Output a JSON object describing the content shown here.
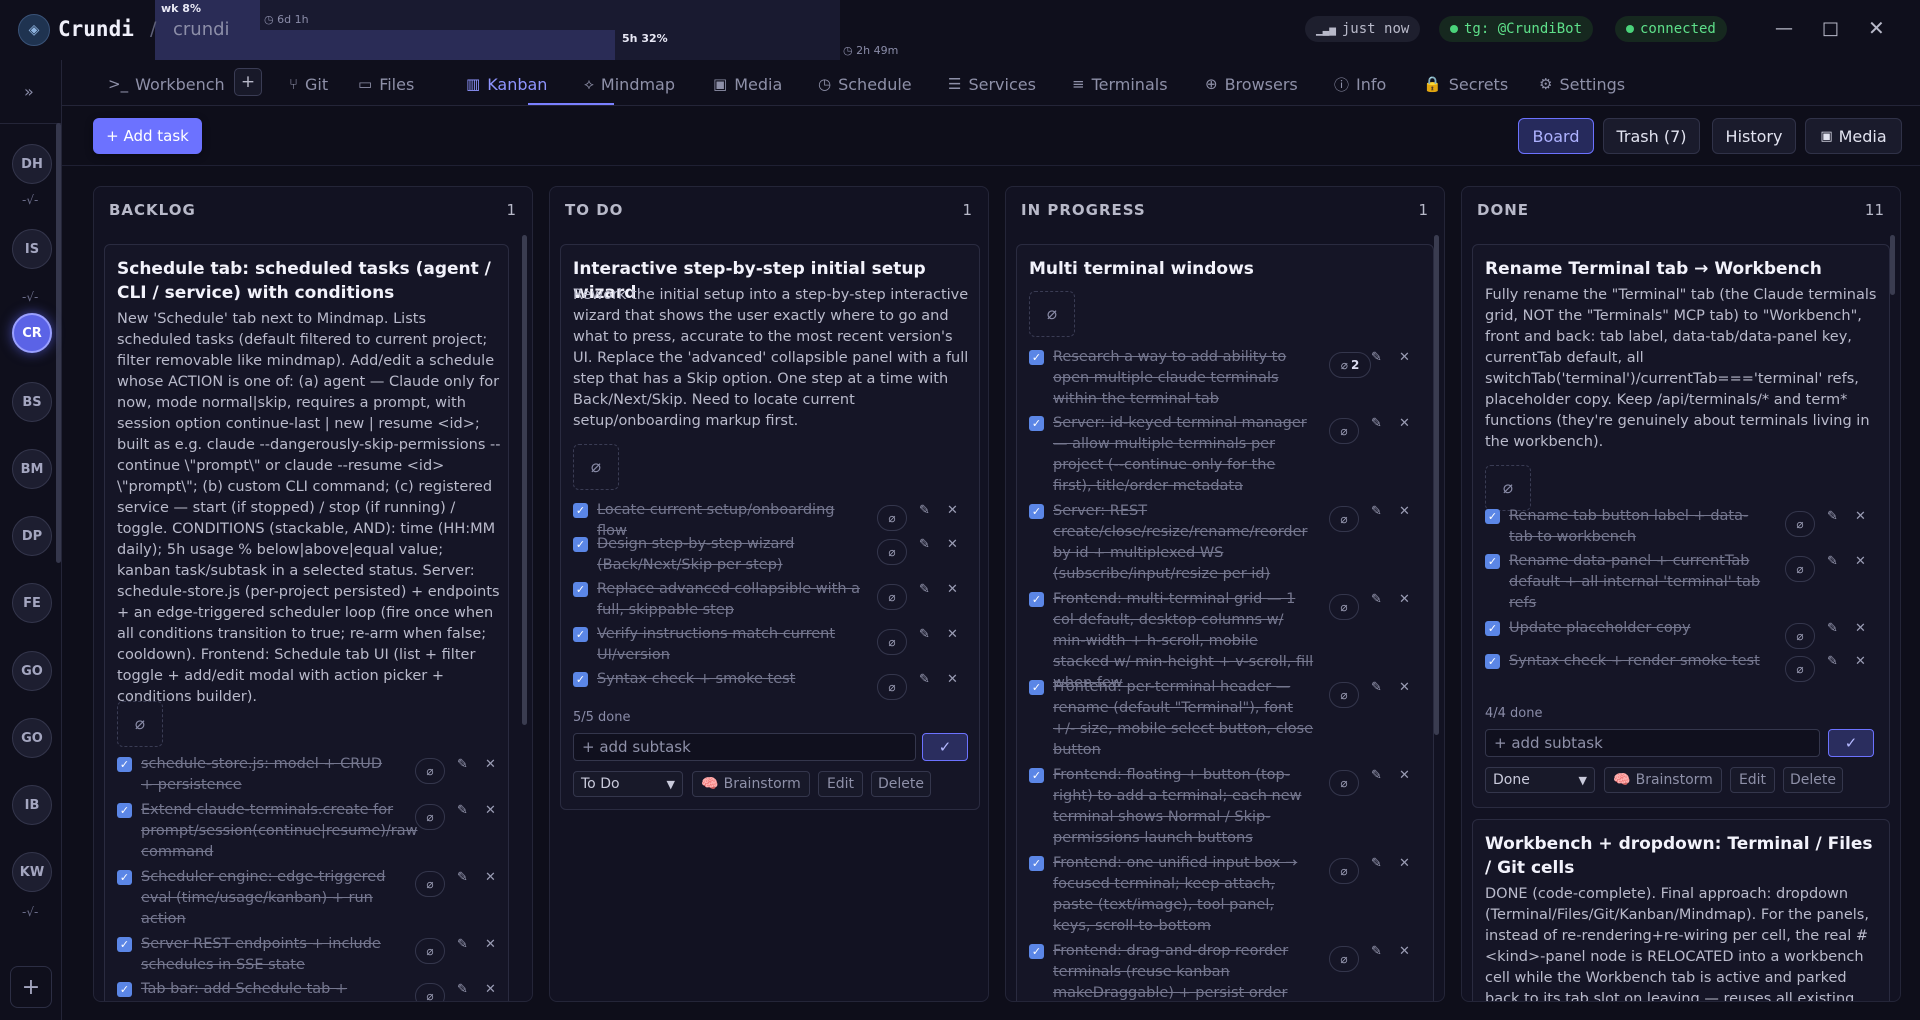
{
  "app": {
    "title": "Crundi",
    "project": "crundi"
  },
  "usage": {
    "week": {
      "label": "wk 8%",
      "reset": "6d 1h",
      "fraction": 0.08
    },
    "session": {
      "label": "5h 32%",
      "reset": "2h 49m",
      "fraction": 0.32
    }
  },
  "status": {
    "updated": "just now",
    "telegram": "tg: @CrundiBot",
    "connection": "connected"
  },
  "window_controls": {
    "minimize": "—",
    "maximize": "□",
    "close": "✕"
  },
  "rail": {
    "expand": "»",
    "projects": [
      "DH",
      "IS",
      "CR",
      "BS",
      "BM",
      "DP",
      "FE",
      "GO",
      "GO",
      "IB",
      "KW"
    ],
    "active_index": 2,
    "add": "+"
  },
  "tabs": [
    {
      "label": "Workbench",
      "icon": "terminal-icon",
      "glyph": ">_"
    },
    {
      "label": "Git",
      "icon": "git-branch-icon",
      "glyph": "⑂"
    },
    {
      "label": "Files",
      "icon": "folder-icon",
      "glyph": "▭"
    },
    {
      "label": "Kanban",
      "icon": "kanban-icon",
      "glyph": "▥"
    },
    {
      "label": "Mindmap",
      "icon": "mindmap-icon",
      "glyph": "⟡"
    },
    {
      "label": "Media",
      "icon": "image-icon",
      "glyph": "▣"
    },
    {
      "label": "Schedule",
      "icon": "clock-icon",
      "glyph": "◷"
    },
    {
      "label": "Services",
      "icon": "server-icon",
      "glyph": "☰"
    },
    {
      "label": "Terminals",
      "icon": "list-icon",
      "glyph": "≡"
    },
    {
      "label": "Browsers",
      "icon": "globe-icon",
      "glyph": "⊕"
    },
    {
      "label": "Info",
      "icon": "info-icon",
      "glyph": "ⓘ"
    },
    {
      "label": "Secrets",
      "icon": "lock-icon",
      "glyph": "🔒"
    },
    {
      "label": "Settings",
      "icon": "gear-icon",
      "glyph": "⚙"
    }
  ],
  "active_tab": "Kanban",
  "tab_add": "+",
  "toolbar": {
    "add_task": "+ Add task",
    "board": "Board",
    "trash": "Trash (7)",
    "history": "History",
    "media": "Media"
  },
  "columns": {
    "backlog": {
      "title": "BACKLOG",
      "count": "1",
      "card": {
        "title": "Schedule tab: scheduled tasks (agent / CLI / service) with conditions",
        "description": "New 'Schedule' tab next to Mindmap. Lists scheduled tasks (default filtered to current project; filter removable like mindmap). Add/edit a schedule whose ACTION is one of: (a) agent — Claude only for now, mode normal|skip, requires a prompt, with session option continue-last | new | resume <id>; built as e.g. claude --dangerously-skip-permissions --continue \\\"prompt\\\" or claude --resume <id> \\\"prompt\\\"; (b) custom CLI command; (c) registered service — start (if stopped) / stop (if running) / toggle. CONDITIONS (stackable, AND): time (HH:MM daily); 5h usage % below|above|equal value; kanban task/subtask in a selected status. Server: schedule-store.js (per-project persisted) + endpoints + an edge-triggered scheduler loop (fire once when all conditions transition to true; re-arm when false; cooldown). Frontend: Schedule tab UI (list + filter toggle + add/edit modal with action picker + conditions builder).",
        "subtasks": [
          {
            "text": "schedule-store.js: model + CRUD + persistence"
          },
          {
            "text": "Extend claude-terminals.create for prompt/session(continue|resume)/raw command"
          },
          {
            "text": "Scheduler engine: edge-triggered eval (time/usage/kanban) + run action"
          },
          {
            "text": "Server REST endpoints + include schedules in SSE state"
          },
          {
            "text": "Tab bar: add Schedule tab + panel;"
          }
        ]
      }
    },
    "todo": {
      "title": "TO DO",
      "count": "1",
      "card": {
        "title": "Interactive step-by-step initial setup wizard",
        "description": "Rework the initial setup into a step-by-step interactive wizard that shows the user exactly where to go and what to press, accurate to the most recent version's UI. Replace the 'advanced' collapsible panel with a full step that has a Skip option. One step at a time with Back/Next/Skip. Need to locate current setup/onboarding markup first.",
        "subtasks": [
          {
            "text": "Locate current setup/onboarding flow"
          },
          {
            "text": "Design step-by-step wizard (Back/Next/Skip per step)"
          },
          {
            "text": "Replace advanced collapsible with a full, skippable step"
          },
          {
            "text": "Verify instructions match current UI/version"
          },
          {
            "text": "Syntax check + smoke test"
          }
        ],
        "done_count": "5/5 done",
        "add_subtask_placeholder": "+ add subtask",
        "status": "To Do",
        "brainstorm": "Brainstorm",
        "edit": "Edit",
        "delete": "Delete"
      }
    },
    "inprogress": {
      "title": "IN PROGRESS",
      "count": "1",
      "card": {
        "title": "Multi terminal windows",
        "subtasks": [
          {
            "text": "Research a way to add ability to open multiple claude terminals within the terminal tab",
            "attachments": "2"
          },
          {
            "text": "Server: id-keyed terminal manager — allow multiple terminals per project (--continue only for the first), title/order metadata"
          },
          {
            "text": "Server: REST create/close/resize/rename/reorder by id + multiplexed WS (subscribe/input/resize per id)"
          },
          {
            "text": "Frontend: multi-terminal grid — 1 col default, desktop columns w/ min-width + h-scroll, mobile stacked w/ min-height + v-scroll, fill when few"
          },
          {
            "text": "Frontend: per-terminal header — rename (default \"Terminal\"), font +/- size, mobile select button, close button"
          },
          {
            "text": "Frontend: floating + button (top-right) to add a terminal; each new terminal shows Normal / Skip-permissions launch buttons"
          },
          {
            "text": "Frontend: one unified input box → focused terminal; keep attach, paste (text/image), tool panel, keys, scroll-to-bottom"
          },
          {
            "text": "Frontend: drag-and-drop reorder terminals (reuse kanban makeDraggable) + persist order"
          }
        ]
      }
    },
    "done": {
      "title": "DONE",
      "count": "11",
      "card": {
        "title": "Rename Terminal tab → Workbench",
        "description": "Fully rename the \"Terminal\" tab (the Claude terminals grid, NOT the \"Terminals\" MCP tab) to \"Workbench\", front and back: tab label, data-tab/data-panel key, currentTab default, all switchTab('terminal')/currentTab==='terminal' refs, placeholder copy. Keep /api/terminals/* and term* functions (they're genuinely about terminals living in the workbench).",
        "subtasks": [
          {
            "text": "Rename tab button label + data-tab to workbench"
          },
          {
            "text": "Rename data-panel + currentTab default + all internal 'terminal' tab refs"
          },
          {
            "text": "Update placeholder copy"
          },
          {
            "text": "Syntax check + render smoke test"
          }
        ],
        "done_count": "4/4 done",
        "add_subtask_placeholder": "+ add subtask",
        "status": "Done",
        "brainstorm": "Brainstorm",
        "edit": "Edit",
        "delete": "Delete"
      },
      "card2": {
        "title": "Workbench + dropdown: Terminal / Files / Git cells",
        "description": "DONE (code-complete). Final approach: dropdown (Terminal/Files/Git/Kanban/Mindmap). For the panels, instead of re-rendering+re-wiring per cell, the real #<kind>-panel node is RELOCATED into a workbench cell while the Workbench tab is active and parked back to its tab slot on leaving — reuses all existing"
      }
    }
  }
}
